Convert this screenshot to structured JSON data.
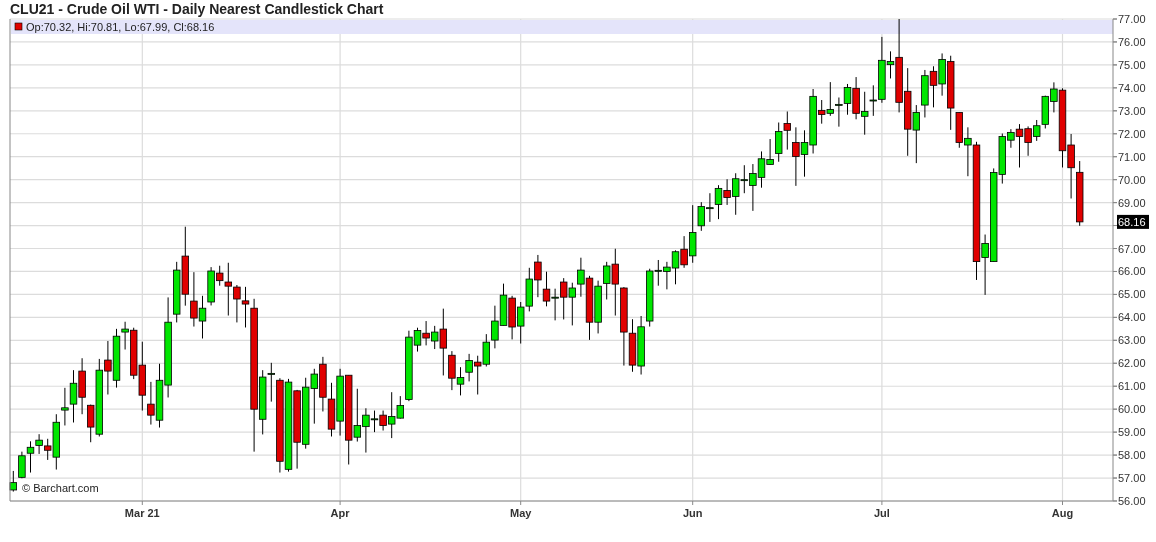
{
  "title": "CLU21 - Crude Oil WTI - Daily Nearest Candlestick Chart",
  "chart": {
    "legend": "Op:70.32, Hi:70.81, Lo:67.99, Cl:68.16",
    "price_tag": "68.16",
    "credit": "© Barchart.com",
    "chart_data": {
      "type": "candlestick",
      "grid": true,
      "ylim": [
        56,
        77
      ],
      "yticks": [
        {
          "value": 56,
          "label": "56.00"
        },
        {
          "value": 57,
          "label": "57.00"
        },
        {
          "value": 58,
          "label": "58.00"
        },
        {
          "value": 59,
          "label": "59.00"
        },
        {
          "value": 60,
          "label": "60.00"
        },
        {
          "value": 61,
          "label": "61.00"
        },
        {
          "value": 62,
          "label": "62.00"
        },
        {
          "value": 63,
          "label": "63.00"
        },
        {
          "value": 64,
          "label": "64.00"
        },
        {
          "value": 65,
          "label": "65.00"
        },
        {
          "value": 66,
          "label": "66.00"
        },
        {
          "value": 67,
          "label": "67.00"
        },
        {
          "value": 69,
          "label": "69.00"
        },
        {
          "value": 70,
          "label": "70.00"
        },
        {
          "value": 71,
          "label": "71.00"
        },
        {
          "value": 72,
          "label": "72.00"
        },
        {
          "value": 73,
          "label": "73.00"
        },
        {
          "value": 74,
          "label": "74.00"
        },
        {
          "value": 75,
          "label": "75.00"
        },
        {
          "value": 76,
          "label": "76.00"
        },
        {
          "value": 77,
          "label": "77.00"
        }
      ],
      "categories": [
        null,
        null,
        null,
        null,
        null,
        null,
        null,
        null,
        null,
        null,
        null,
        null,
        null,
        null,
        null,
        "Mar 21",
        null,
        null,
        null,
        null,
        null,
        null,
        null,
        null,
        null,
        null,
        null,
        null,
        null,
        null,
        null,
        null,
        null,
        null,
        null,
        null,
        null,
        null,
        "Apr",
        null,
        null,
        null,
        null,
        null,
        null,
        null,
        null,
        null,
        null,
        null,
        null,
        null,
        null,
        null,
        null,
        null,
        null,
        null,
        null,
        "May",
        null,
        null,
        null,
        null,
        null,
        null,
        null,
        null,
        null,
        null,
        null,
        null,
        null,
        null,
        null,
        null,
        null,
        null,
        null,
        "Jun",
        null,
        null,
        null,
        null,
        null,
        null,
        null,
        null,
        null,
        null,
        null,
        null,
        null,
        null,
        null,
        null,
        null,
        null,
        null,
        null,
        null,
        "Jul",
        null,
        null,
        null,
        null,
        null,
        null,
        null,
        null,
        null,
        null,
        null,
        null,
        null,
        null,
        null,
        null,
        null,
        null,
        null,
        null,
        "Aug",
        null,
        null
      ],
      "ohlc": [
        [
          56.48,
          57.31,
          56.41,
          56.8
        ],
        [
          57.03,
          58.15,
          56.99,
          57.97
        ],
        [
          58.08,
          58.6,
          57.24,
          58.34
        ],
        [
          58.42,
          58.91,
          58.05,
          58.65
        ],
        [
          58.4,
          58.71,
          57.79,
          58.21
        ],
        [
          57.91,
          59.78,
          57.37,
          59.43
        ],
        [
          59.96,
          60.93,
          59.29,
          60.06
        ],
        [
          60.22,
          61.7,
          59.42,
          61.13
        ],
        [
          61.66,
          62.22,
          59.78,
          60.52
        ],
        [
          60.17,
          60.2,
          58.56,
          59.22
        ],
        [
          58.91,
          62.19,
          58.81,
          61.7
        ],
        [
          62.14,
          62.97,
          60.64,
          61.66
        ],
        [
          61.26,
          63.5,
          60.94,
          63.18
        ],
        [
          63.36,
          63.81,
          62.6,
          63.49
        ],
        [
          63.44,
          63.55,
          61.31,
          61.48
        ],
        [
          61.92,
          62.94,
          59.94,
          60.61
        ],
        [
          60.22,
          61.19,
          59.33,
          59.74
        ],
        [
          59.52,
          61.98,
          59.2,
          61.26
        ],
        [
          61.05,
          64.87,
          60.51,
          63.79
        ],
        [
          64.14,
          66.42,
          63.78,
          66.06
        ],
        [
          66.67,
          67.95,
          64.51,
          65.01
        ],
        [
          64.71,
          65.97,
          63.6,
          63.97
        ],
        [
          63.84,
          64.94,
          63.08,
          64.4
        ],
        [
          64.67,
          66.19,
          64.52,
          66.02
        ],
        [
          65.93,
          66.25,
          65.38,
          65.6
        ],
        [
          65.54,
          66.38,
          64.08,
          65.36
        ],
        [
          65.32,
          65.41,
          63.78,
          64.8
        ],
        [
          64.72,
          65.33,
          63.56,
          64.58
        ],
        [
          64.4,
          64.81,
          58.15,
          60.0
        ],
        [
          59.56,
          61.7,
          58.9,
          61.4
        ],
        [
          61.55,
          62.02,
          60.33,
          61.56
        ],
        [
          61.26,
          61.35,
          57.24,
          57.73
        ],
        [
          57.38,
          61.32,
          57.28,
          61.18
        ],
        [
          60.8,
          60.84,
          57.41,
          58.56
        ],
        [
          58.47,
          61.37,
          58.28,
          60.96
        ],
        [
          60.9,
          61.76,
          59.37,
          61.53
        ],
        [
          61.96,
          62.28,
          59.9,
          60.52
        ],
        [
          60.44,
          61.15,
          58.81,
          59.13
        ],
        [
          59.48,
          61.76,
          58.85,
          61.44
        ],
        [
          61.48,
          61.48,
          57.59,
          58.65
        ],
        [
          58.78,
          60.89,
          58.59,
          59.29
        ],
        [
          59.24,
          60.04,
          58.11,
          59.74
        ],
        [
          59.56,
          59.94,
          59.0,
          59.58
        ],
        [
          59.74,
          59.94,
          59.07,
          59.29
        ],
        [
          59.35,
          60.74,
          58.74,
          59.68
        ],
        [
          59.61,
          60.57,
          59.59,
          60.16
        ],
        [
          60.42,
          63.42,
          60.35,
          63.14
        ],
        [
          62.79,
          63.55,
          62.51,
          63.43
        ],
        [
          63.31,
          63.84,
          62.78,
          63.1
        ],
        [
          62.97,
          63.63,
          62.62,
          63.36
        ],
        [
          63.49,
          64.38,
          61.47,
          62.66
        ],
        [
          62.35,
          62.53,
          60.83,
          61.35
        ],
        [
          61.09,
          61.83,
          60.6,
          61.38
        ],
        [
          61.61,
          62.41,
          61.21,
          62.12
        ],
        [
          62.05,
          62.33,
          60.64,
          61.88
        ],
        [
          61.96,
          63.27,
          61.86,
          62.92
        ],
        [
          63.01,
          64.51,
          62.65,
          63.84
        ],
        [
          63.65,
          65.47,
          63.65,
          64.97
        ],
        [
          64.84,
          64.94,
          63.04,
          63.58
        ],
        [
          63.62,
          64.67,
          62.86,
          64.45
        ],
        [
          64.49,
          66.16,
          64.26,
          65.67
        ],
        [
          66.41,
          66.72,
          64.88,
          65.63
        ],
        [
          65.23,
          65.99,
          64.48,
          64.71
        ],
        [
          64.88,
          65.25,
          63.87,
          64.88
        ],
        [
          65.54,
          65.71,
          63.91,
          64.88
        ],
        [
          64.88,
          65.51,
          63.65,
          65.28
        ],
        [
          65.45,
          66.6,
          64.9,
          66.06
        ],
        [
          65.71,
          65.81,
          63.02,
          63.79
        ],
        [
          63.79,
          65.6,
          63.3,
          65.36
        ],
        [
          65.48,
          66.42,
          64.78,
          66.24
        ],
        [
          66.32,
          66.99,
          64.08,
          65.45
        ],
        [
          65.28,
          65.32,
          61.9,
          63.36
        ],
        [
          63.31,
          63.92,
          61.63,
          61.92
        ],
        [
          61.88,
          64.06,
          61.51,
          63.59
        ],
        [
          63.84,
          66.12,
          63.6,
          66.02
        ],
        [
          66.03,
          66.5,
          65.38,
          66.05
        ],
        [
          66.0,
          66.42,
          65.22,
          66.19
        ],
        [
          66.15,
          66.92,
          65.44,
          66.86
        ],
        [
          66.97,
          67.54,
          66.16,
          66.29
        ],
        [
          66.68,
          68.89,
          66.38,
          67.7
        ],
        [
          67.99,
          69.02,
          67.77,
          68.83
        ],
        [
          68.77,
          69.41,
          68.16,
          68.78
        ],
        [
          68.92,
          69.76,
          68.28,
          69.62
        ],
        [
          69.53,
          70.02,
          68.9,
          69.22
        ],
        [
          69.27,
          70.28,
          68.47,
          70.04
        ],
        [
          69.99,
          70.63,
          69.41,
          70.0
        ],
        [
          69.75,
          70.68,
          68.64,
          70.27
        ],
        [
          70.1,
          71.23,
          69.65,
          70.91
        ],
        [
          70.66,
          71.77,
          70.65,
          70.88
        ],
        [
          71.14,
          72.49,
          70.78,
          72.1
        ],
        [
          72.45,
          72.97,
          71.31,
          72.15
        ],
        [
          71.62,
          72.28,
          69.73,
          71.01
        ],
        [
          71.1,
          72.15,
          70.13,
          71.62
        ],
        [
          71.51,
          73.95,
          71.14,
          73.63
        ],
        [
          73.02,
          73.47,
          72.44,
          72.84
        ],
        [
          72.89,
          74.25,
          72.78,
          73.06
        ],
        [
          73.27,
          73.58,
          72.31,
          73.28
        ],
        [
          73.32,
          74.17,
          72.83,
          74.02
        ],
        [
          73.98,
          74.47,
          72.63,
          72.89
        ],
        [
          72.76,
          73.83,
          71.96,
          72.97
        ],
        [
          73.46,
          74.11,
          72.78,
          73.47
        ],
        [
          73.5,
          76.22,
          73.35,
          75.2
        ],
        [
          75.01,
          75.59,
          74.41,
          75.15
        ],
        [
          75.33,
          77.0,
          72.93,
          73.37
        ],
        [
          73.85,
          74.86,
          71.04,
          72.2
        ],
        [
          72.16,
          73.25,
          70.72,
          72.93
        ],
        [
          73.25,
          74.78,
          72.71,
          74.53
        ],
        [
          74.72,
          74.94,
          73.15,
          74.11
        ],
        [
          74.17,
          75.5,
          73.66,
          75.24
        ],
        [
          75.15,
          75.4,
          72.17,
          73.12
        ],
        [
          72.93,
          72.93,
          71.39,
          71.62
        ],
        [
          71.51,
          72.28,
          70.15,
          71.8
        ],
        [
          71.51,
          71.65,
          65.63,
          66.43
        ],
        [
          66.61,
          67.61,
          64.98,
          67.22
        ],
        [
          66.43,
          70.49,
          66.43,
          70.31
        ],
        [
          70.23,
          72.01,
          69.83,
          71.88
        ],
        [
          71.72,
          72.2,
          71.39,
          72.06
        ],
        [
          72.2,
          72.42,
          70.53,
          71.88
        ],
        [
          72.22,
          72.32,
          71.04,
          71.62
        ],
        [
          71.88,
          72.6,
          71.69,
          72.35
        ],
        [
          72.41,
          73.66,
          72.23,
          73.63
        ],
        [
          73.41,
          74.24,
          72.93,
          73.95
        ],
        [
          73.9,
          73.98,
          70.53,
          71.26
        ],
        [
          71.51,
          71.99,
          69.18,
          70.52
        ],
        [
          70.32,
          70.81,
          67.99,
          68.16
        ]
      ]
    }
  }
}
